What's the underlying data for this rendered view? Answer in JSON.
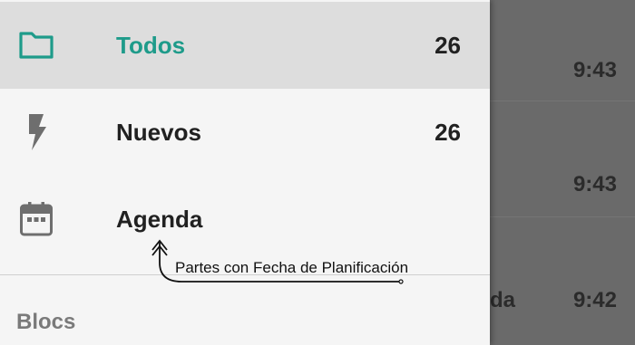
{
  "drawer": {
    "items": [
      {
        "label": "Todos",
        "count": "26",
        "icon": "folder-icon",
        "selected": true
      },
      {
        "label": "Nuevos",
        "count": "26",
        "icon": "lightning-icon",
        "selected": false
      },
      {
        "label": "Agenda",
        "count": "",
        "icon": "calendar-icon",
        "selected": false
      }
    ],
    "section_header": "Blocs"
  },
  "annotation": {
    "text": "Partes con Fecha de Planificación"
  },
  "background_list": {
    "times": [
      "9:43",
      "9:43",
      "9:42"
    ],
    "partial_text": "da"
  },
  "colors": {
    "accent": "#1e9b8a",
    "selected_bg": "#dddddd",
    "drawer_bg": "#f5f5f5",
    "scrim": "#6b6b6b"
  }
}
